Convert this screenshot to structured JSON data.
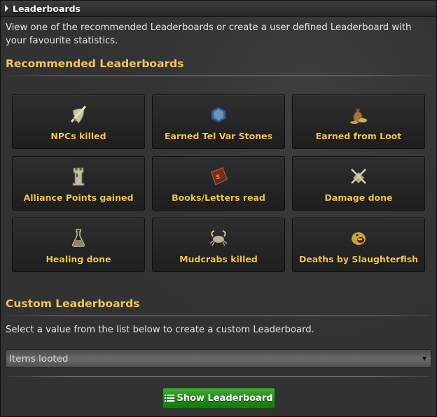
{
  "window": {
    "title": "Leaderboards"
  },
  "intro_text": "View one of the recommended Leaderboards or create a user defined Leaderboard with your favourite statistics.",
  "recommended": {
    "heading": "Recommended Leaderboards",
    "tiles": [
      {
        "label": "NPCs killed",
        "icon": "shield-sword-icon"
      },
      {
        "label": "Earned Tel Var Stones",
        "icon": "tel-var-stone-icon"
      },
      {
        "label": "Earned from Loot",
        "icon": "gold-bag-icon"
      },
      {
        "label": "Alliance Points gained",
        "icon": "tower-icon"
      },
      {
        "label": "Books/Letters read",
        "icon": "book-icon"
      },
      {
        "label": "Damage done",
        "icon": "crossed-swords-icon"
      },
      {
        "label": "Healing done",
        "icon": "potion-flask-icon"
      },
      {
        "label": "Mudcrabs killed",
        "icon": "mudcrab-icon"
      },
      {
        "label": "Deaths by Slaughterfish",
        "icon": "slaughterfish-icon"
      }
    ]
  },
  "custom": {
    "heading": "Custom Leaderboards",
    "description": "Select a value from the list below to create a custom Leaderboard.",
    "select_value": "Items looted",
    "button_label": "Show Leaderboard"
  },
  "colors": {
    "accent_gold": "#f0c845",
    "button_green": "#1f8a17"
  }
}
